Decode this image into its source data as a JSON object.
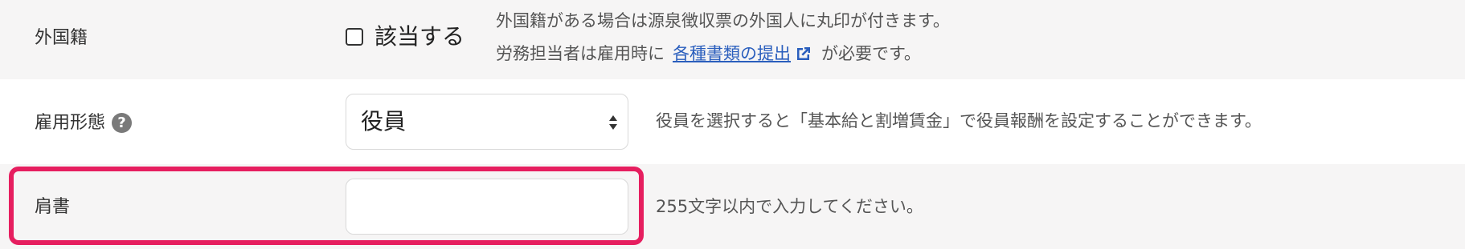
{
  "foreign": {
    "label": "外国籍",
    "checkbox_label": "該当する",
    "desc_line1": "外国籍がある場合は源泉徴収票の外国人に丸印が付きます。",
    "desc_line2_prefix": "労務担当者は雇用時に",
    "desc_link": "各種書類の提出",
    "desc_line2_suffix": "が必要です。",
    "checked": false
  },
  "employment": {
    "label": "雇用形態",
    "help_icon": "?",
    "select_value": "役員",
    "description": "役員を選択すると「基本給と割増賃金」で役員報酬を設定することができます。"
  },
  "title_field": {
    "label": "肩書",
    "value": "",
    "description": "255文字以内で入力してください。"
  },
  "colors": {
    "highlight": "#e61e5f",
    "link": "#2a5ebd",
    "row_alt_bg": "#f6f5f5"
  }
}
